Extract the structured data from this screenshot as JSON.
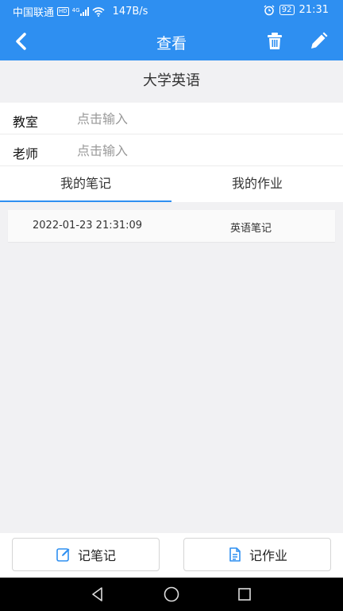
{
  "status_bar": {
    "carrier": "中国联通",
    "hd": "HD",
    "network": "4G",
    "speed": "147B/s",
    "battery": "92",
    "time": "21:31",
    "icons": [
      "hd-badge-icon",
      "signal-icon",
      "wifi-icon",
      "alarm-icon",
      "battery-icon"
    ]
  },
  "app_bar": {
    "title": "查看",
    "icons": [
      "back-icon",
      "trash-icon",
      "edit-icon"
    ]
  },
  "course": {
    "name": "大学英语"
  },
  "fields": [
    {
      "label": "教室",
      "value": "",
      "placeholder": "点击输入"
    },
    {
      "label": "老师",
      "value": "",
      "placeholder": "点击输入"
    }
  ],
  "tabs": [
    {
      "label": "我的笔记",
      "active": true
    },
    {
      "label": "我的作业",
      "active": false
    }
  ],
  "notes": [
    {
      "date": "2022-01-23 21:31:09",
      "title": "英语笔记"
    }
  ],
  "bottom_buttons": {
    "note_label": "记笔记",
    "homework_label": "记作业"
  },
  "colors": {
    "accent": "#2e8ff1",
    "background": "#f1f1f3"
  }
}
